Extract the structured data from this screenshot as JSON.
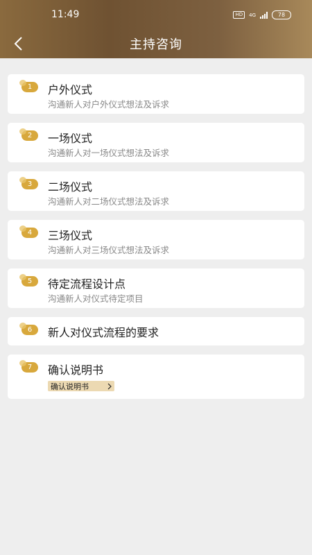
{
  "status_bar": {
    "time": "11:49",
    "hd": "HD",
    "network": "4G",
    "battery": "78"
  },
  "nav": {
    "back_icon": "chevron-left-icon",
    "title": "主持咨询"
  },
  "colors": {
    "header_gradient": [
      "#8a6a3e",
      "#a8895a"
    ],
    "badge": "#d8a83c",
    "button_bg": "#ecd9b2",
    "page_bg": "#eeeeee"
  },
  "items": [
    {
      "num": "1",
      "title": "户外仪式",
      "subtitle": "沟通新人对户外仪式想法及诉求"
    },
    {
      "num": "2",
      "title": "一场仪式",
      "subtitle": "沟通新人对一场仪式想法及诉求"
    },
    {
      "num": "3",
      "title": "二场仪式",
      "subtitle": "沟通新人对二场仪式想法及诉求"
    },
    {
      "num": "4",
      "title": "三场仪式",
      "subtitle": "沟通新人对三场仪式想法及诉求"
    },
    {
      "num": "5",
      "title": "待定流程设计点",
      "subtitle": "沟通新人对仪式待定项目"
    },
    {
      "num": "6",
      "title": "新人对仪式流程的要求"
    },
    {
      "num": "7",
      "title": "确认说明书",
      "button_label": "确认说明书"
    }
  ]
}
